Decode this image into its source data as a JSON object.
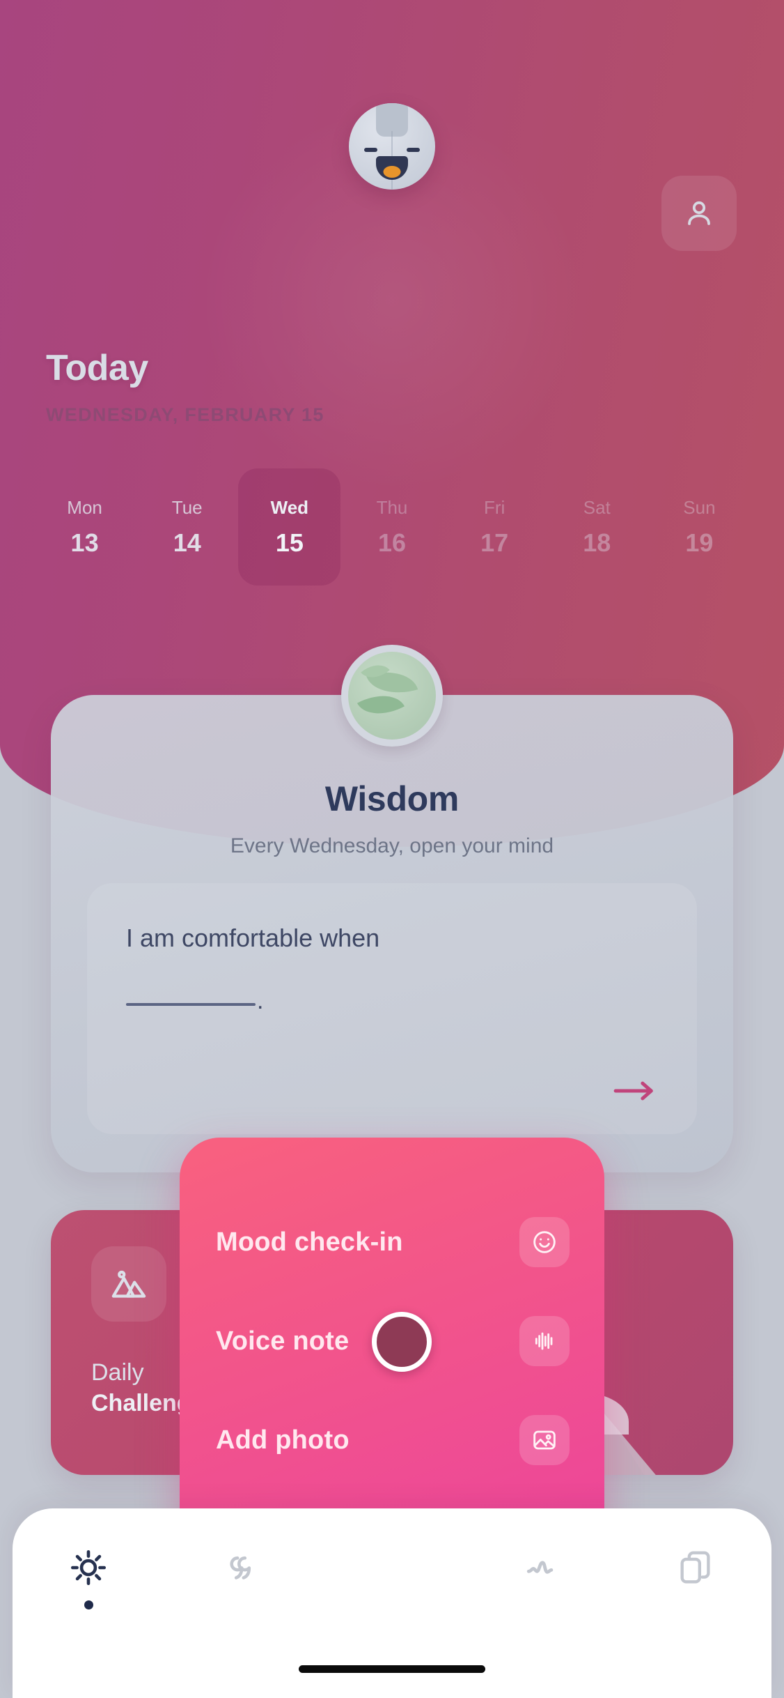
{
  "header": {
    "title": "Today",
    "date": "WEDNESDAY, FEBRUARY 15",
    "profile_icon": "person-icon",
    "mascot_icon": "mascot-avatar"
  },
  "day_strip": [
    {
      "name": "Mon",
      "num": "13",
      "state": "past"
    },
    {
      "name": "Tue",
      "num": "14",
      "state": "past"
    },
    {
      "name": "Wed",
      "num": "15",
      "state": "selected"
    },
    {
      "name": "Thu",
      "num": "16",
      "state": "future"
    },
    {
      "name": "Fri",
      "num": "17",
      "state": "future"
    },
    {
      "name": "Sat",
      "num": "18",
      "state": "future"
    },
    {
      "name": "Sun",
      "num": "19",
      "state": "future"
    }
  ],
  "wisdom_card": {
    "badge_icon": "leaf-icon",
    "title": "Wisdom",
    "subtitle": "Every Wednesday, open your mind",
    "prompt_text": "I am comfortable when",
    "prompt_blank_suffix": ".",
    "submit_icon": "arrow-right-icon"
  },
  "challenge_card": {
    "icon": "image-mountain-icon",
    "label_line1": "Daily",
    "label_line2": "Challenge"
  },
  "action_menu": {
    "items": [
      {
        "label": "Mood check-in",
        "icon": "smiley-icon"
      },
      {
        "label": "Voice note",
        "icon": "audio-waveform-icon"
      },
      {
        "label": "Add photo",
        "icon": "image-icon"
      }
    ],
    "close_icon": "close-x-icon"
  },
  "bottom_nav": {
    "items": [
      {
        "icon": "sun-icon",
        "active": true
      },
      {
        "icon": "quote-marks-icon",
        "active": false
      },
      {
        "icon": "wave-icon",
        "active": false
      },
      {
        "icon": "cards-stack-icon",
        "active": false
      }
    ]
  },
  "colors": {
    "header_gradient_start": "#a8457f",
    "header_gradient_end": "#b55166",
    "body_bg": "#c3c7d1",
    "accent_pink": "#ea3f9e",
    "accent_pink_light": "#f9617f",
    "navy": "#2e3a5c",
    "challenge_card": "#b8496e",
    "nav_bg": "#ffffff"
  }
}
